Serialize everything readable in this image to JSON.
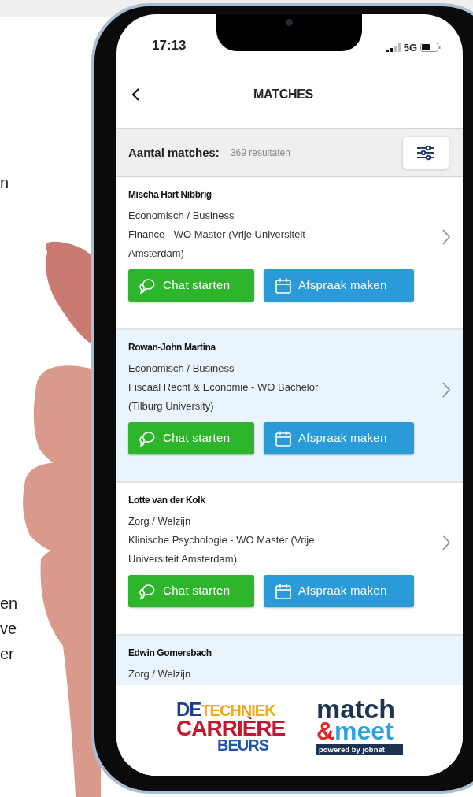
{
  "side_text_fragments": [
    "n",
    "en",
    "ve",
    "er"
  ],
  "status_bar": {
    "time": "17:13",
    "network": "5G"
  },
  "header": {
    "title": "MATCHES"
  },
  "summary": {
    "label": "Aantal matches:",
    "count": "369 resultaten"
  },
  "matches": [
    {
      "name": "Mischa Hart Nibbrig",
      "lines": [
        "Economisch / Business",
        "Finance - WO Master (Vrije Universiteit Amsterdam)"
      ],
      "actions": [
        {
          "kind": "chat",
          "label": "Chat starten"
        },
        {
          "kind": "appointment",
          "label": "Afspraak maken"
        }
      ]
    },
    {
      "name": "Rowan-John Martina",
      "lines": [
        "Economisch / Business",
        "Fiscaal Recht & Economie - WO Bachelor (Tilburg University)"
      ],
      "actions": [
        {
          "kind": "chat",
          "label": "Chat starten"
        },
        {
          "kind": "appointment",
          "label": "Afspraak maken"
        }
      ]
    },
    {
      "name": "Lotte van der Kolk",
      "lines": [
        "Zorg / Welzijn",
        "Klinische Psychologie - WO Master (Vrije Universiteit Amsterdam)"
      ],
      "actions": [
        {
          "kind": "chat",
          "label": "Chat starten"
        },
        {
          "kind": "appointment",
          "label": "Afspraak maken"
        }
      ]
    },
    {
      "name": "Edwin Gomersbach",
      "lines": [
        "Zorg / Welzijn"
      ]
    }
  ],
  "footer_logos": [
    {
      "kind": "techniek",
      "parts": [
        "DE",
        "TECHNIEK",
        "CARRIÈRE",
        "BEURS"
      ]
    },
    {
      "kind": "matchmeet",
      "parts": [
        "match",
        "&meet",
        "powered by jobnet"
      ]
    }
  ]
}
